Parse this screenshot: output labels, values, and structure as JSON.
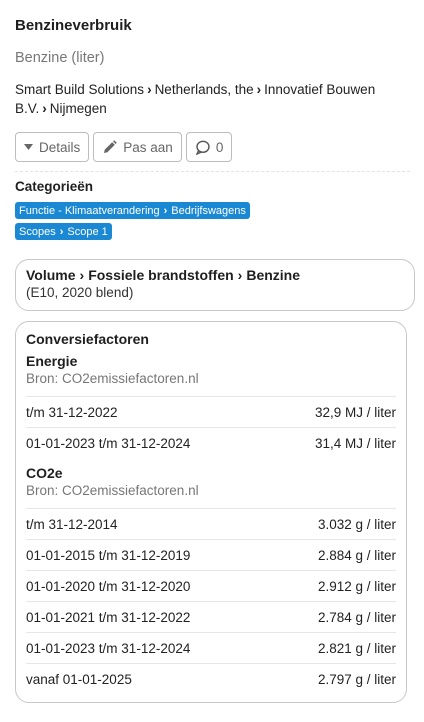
{
  "title": "Benzineverbruik",
  "subtitle": "Benzine (liter)",
  "location": [
    "Smart Build Solutions",
    "Netherlands, the",
    "Innovatief Bouwen B.V.",
    "Nijmegen"
  ],
  "buttons": {
    "details": "Details",
    "edit": "Pas aan",
    "comments": "0"
  },
  "categories": {
    "title": "Categorieën",
    "badge1": [
      "Functie - Klimaatverandering",
      "Bedrijfswagens"
    ],
    "badge2": [
      "Scopes",
      "Scope 1"
    ]
  },
  "volume": {
    "path": [
      "Volume",
      "Fossiele brandstoffen",
      "Benzine"
    ],
    "note": "(E10, 2020 blend)"
  },
  "conversion": {
    "title": "Conversiefactoren",
    "energy": {
      "title": "Energie",
      "source": "Bron: CO2emissiefactoren.nl",
      "rows": [
        {
          "period": "t/m 31-12-2022",
          "value": "32,9 MJ / liter"
        },
        {
          "period": "01-01-2023 t/m 31-12-2024",
          "value": "31,4 MJ / liter"
        }
      ]
    },
    "co2e": {
      "title": "CO2e",
      "source": "Bron: CO2emissiefactoren.nl",
      "rows": [
        {
          "period": "t/m 31-12-2014",
          "value": "3.032 g / liter"
        },
        {
          "period": "01-01-2015 t/m 31-12-2019",
          "value": "2.884 g / liter"
        },
        {
          "period": "01-01-2020 t/m 31-12-2020",
          "value": "2.912 g / liter"
        },
        {
          "period": "01-01-2021 t/m 31-12-2022",
          "value": "2.784 g / liter"
        },
        {
          "period": "01-01-2023 t/m 31-12-2024",
          "value": "2.821 g / liter"
        },
        {
          "period": "vanaf 01-01-2025",
          "value": "2.797 g / liter"
        }
      ]
    }
  }
}
